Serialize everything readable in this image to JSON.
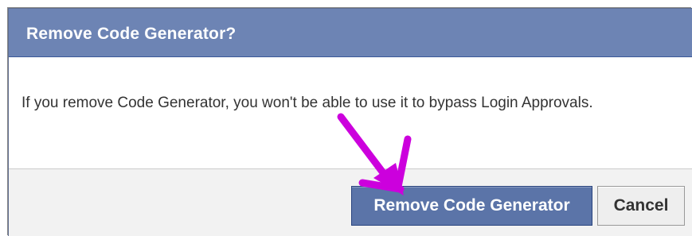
{
  "dialog": {
    "title": "Remove Code Generator?",
    "message": "If you remove Code Generator, you won't be able to use it to bypass Login Approvals.",
    "buttons": {
      "confirm_label": "Remove Code Generator",
      "cancel_label": "Cancel"
    }
  },
  "colors": {
    "header_background": "#6d84b4",
    "primary_button": "#5b74a8",
    "annotation_arrow": "#cc00dd"
  },
  "annotation": {
    "icon": "arrow-pointing-at-confirm-button"
  }
}
